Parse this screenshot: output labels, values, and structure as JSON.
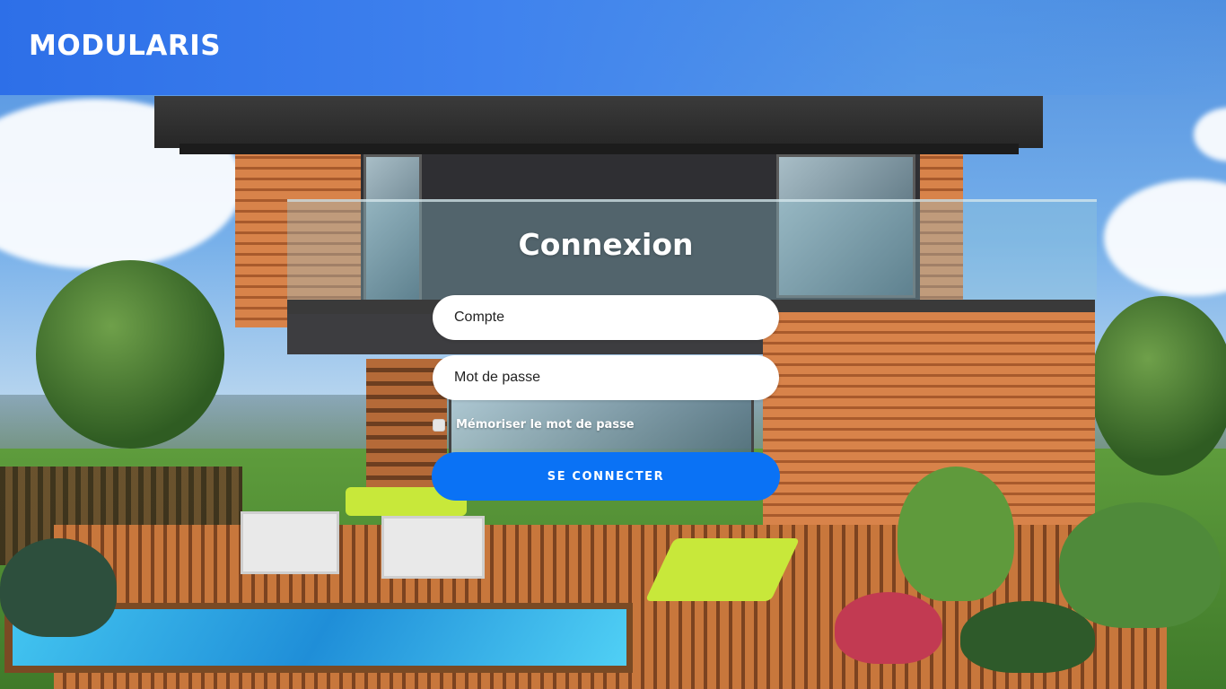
{
  "header": {
    "brand": "MODULARIS",
    "accent_color": "#2d6fe8"
  },
  "login": {
    "title": "Connexion",
    "account_placeholder": "Compte",
    "account_value": "",
    "password_placeholder": "Mot de passe",
    "password_value": "",
    "remember_label": "Mémoriser le mot de passe",
    "remember_checked": false,
    "submit_label": "SE CONNECTER",
    "submit_color": "#0a72f5"
  },
  "background": {
    "description_icon": "house-photo"
  }
}
